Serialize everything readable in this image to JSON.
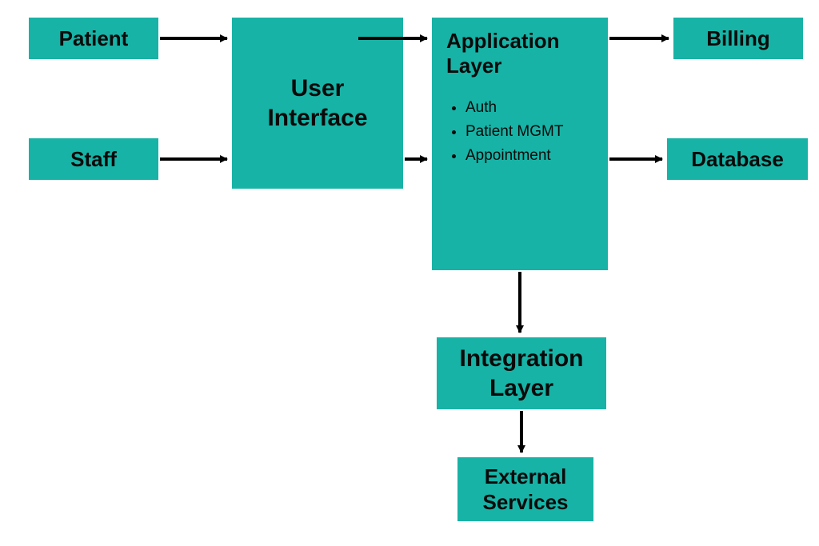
{
  "boxes": {
    "patient": "Patient",
    "staff": "Staff",
    "user_interface": "User\nInterface",
    "billing": "Billing",
    "database": "Database",
    "integration_layer": "Integration\nLayer",
    "external_services": "External\nServices"
  },
  "app_layer": {
    "title": "Application\nLayer",
    "items": [
      "Auth",
      "Patient MGMT",
      "Appointment"
    ]
  },
  "colors": {
    "box_bg": "#17b3a6",
    "text": "#0a0a0a",
    "arrow": "#000000"
  }
}
